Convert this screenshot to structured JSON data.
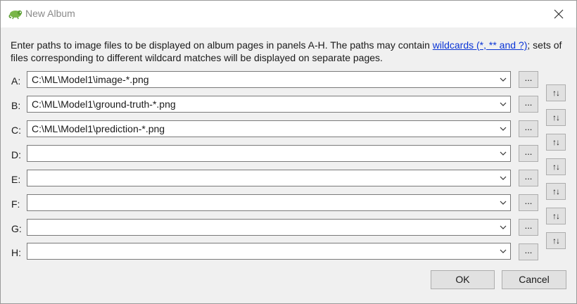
{
  "window": {
    "title": "New Album",
    "app_icon": "chameleon-icon",
    "close_icon": "close-icon"
  },
  "description": {
    "text_before_link": "Enter paths to image files to be displayed on album pages in panels A-H. The paths may contain ",
    "link_text": "wildcards (*, ** and ?)",
    "text_after_link": "; sets of files corresponding to different wildcard matches will be displayed on separate pages."
  },
  "rows": [
    {
      "label": "A:",
      "value": "C:\\ML\\Model1\\image-*.png"
    },
    {
      "label": "B:",
      "value": "C:\\ML\\Model1\\ground-truth-*.png"
    },
    {
      "label": "C:",
      "value": "C:\\ML\\Model1\\prediction-*.png"
    },
    {
      "label": "D:",
      "value": ""
    },
    {
      "label": "E:",
      "value": ""
    },
    {
      "label": "F:",
      "value": ""
    },
    {
      "label": "G:",
      "value": ""
    },
    {
      "label": "H:",
      "value": ""
    }
  ],
  "browse_label": "...",
  "swap_label": "↑↓",
  "buttons": {
    "ok": "OK",
    "cancel": "Cancel"
  },
  "colors": {
    "link": "#0b35d6",
    "dialog_background": "#f0f0f0",
    "button_face": "#e1e1e1"
  }
}
